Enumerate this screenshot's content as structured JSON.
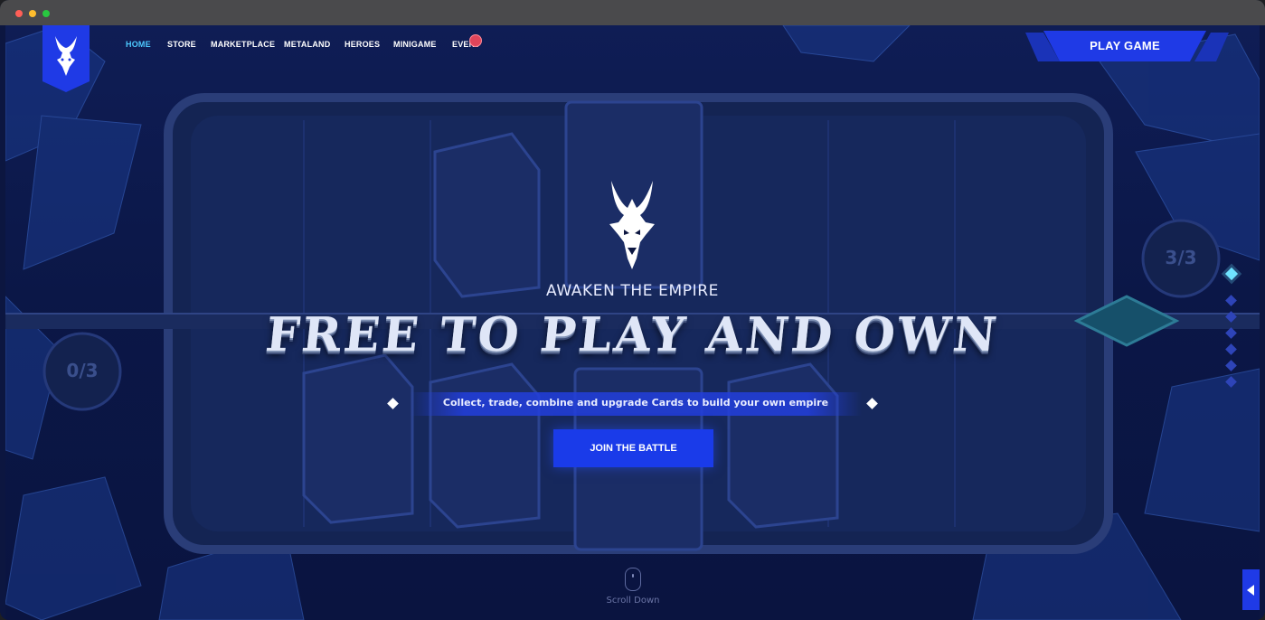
{
  "nav": {
    "items": [
      {
        "label": "HOME",
        "active": true
      },
      {
        "label": "STORE",
        "active": false
      },
      {
        "label": "MARKETPLACE",
        "active": false
      },
      {
        "label": "METALAND",
        "active": false
      },
      {
        "label": "HEROES",
        "active": false
      },
      {
        "label": "MINIGAME",
        "active": false
      },
      {
        "label": "EVENT",
        "active": false
      }
    ],
    "play_label": "PLAY GAME"
  },
  "hero": {
    "tagline": "AWAKEN THE EMPIRE",
    "headline": "FREE TO PLAY AND OWN",
    "subtitle": "Collect, trade, combine and upgrade Cards to build your own empire",
    "cta_label": "JOIN THE BATTLE"
  },
  "board": {
    "left_counter": "0/3",
    "right_counter": "3/3"
  },
  "pagination": {
    "count": 7,
    "active_index": 0
  },
  "scroll": {
    "label": "Scroll Down"
  },
  "colors": {
    "accent": "#1f3ae6",
    "nav_active": "#4dc9ff",
    "background": "#0c1640",
    "event_badge": "#e0455a",
    "active_dot": "#6fe3ff"
  },
  "icons": {
    "brand": "dragon-head-icon",
    "scroll": "mouse-icon",
    "side_tab": "caret-left-icon"
  }
}
